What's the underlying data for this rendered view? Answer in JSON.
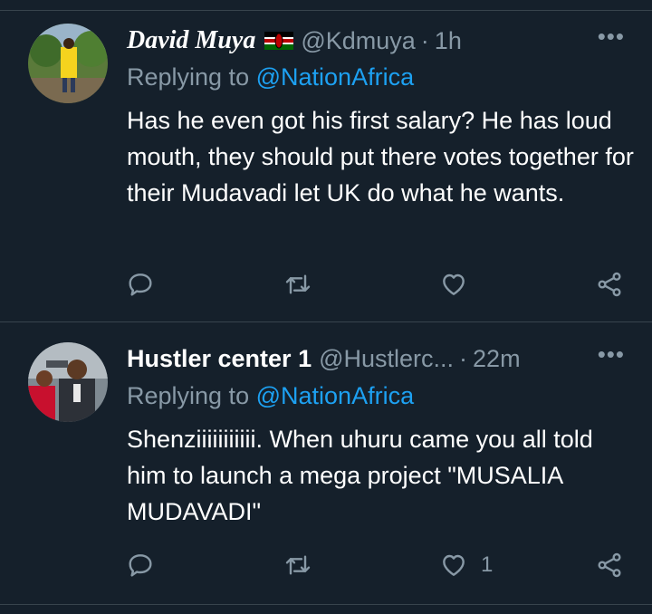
{
  "tweets": [
    {
      "name": "David Muya",
      "handle": "@Kdmuya",
      "separator": "·",
      "time": "1h",
      "reply_prefix": "Replying to",
      "reply_to": "@NationAfrica",
      "text": "Has he even got his first salary? He has loud mouth, they should put there votes together for their Mudavadi let UK do what he wants.",
      "like_count": ""
    },
    {
      "name": "Hustler center 1",
      "handle": "@Hustlerc...",
      "separator": "·",
      "time": "22m",
      "reply_prefix": "Replying to",
      "reply_to": "@NationAfrica",
      "text": "Shenziiiiiiiiiii. When uhuru came you all told him to launch a mega project \"MUSALIA MUDAVADI\"",
      "like_count": "1"
    }
  ],
  "more_glyph": "•••",
  "colors": {
    "background": "#15202b",
    "muted": "#8899a6",
    "accent": "#1da1f2",
    "divider": "#38444d"
  },
  "icons": [
    "reply-icon",
    "retweet-icon",
    "like-icon",
    "share-icon",
    "kenya-flag-icon",
    "more-icon"
  ]
}
